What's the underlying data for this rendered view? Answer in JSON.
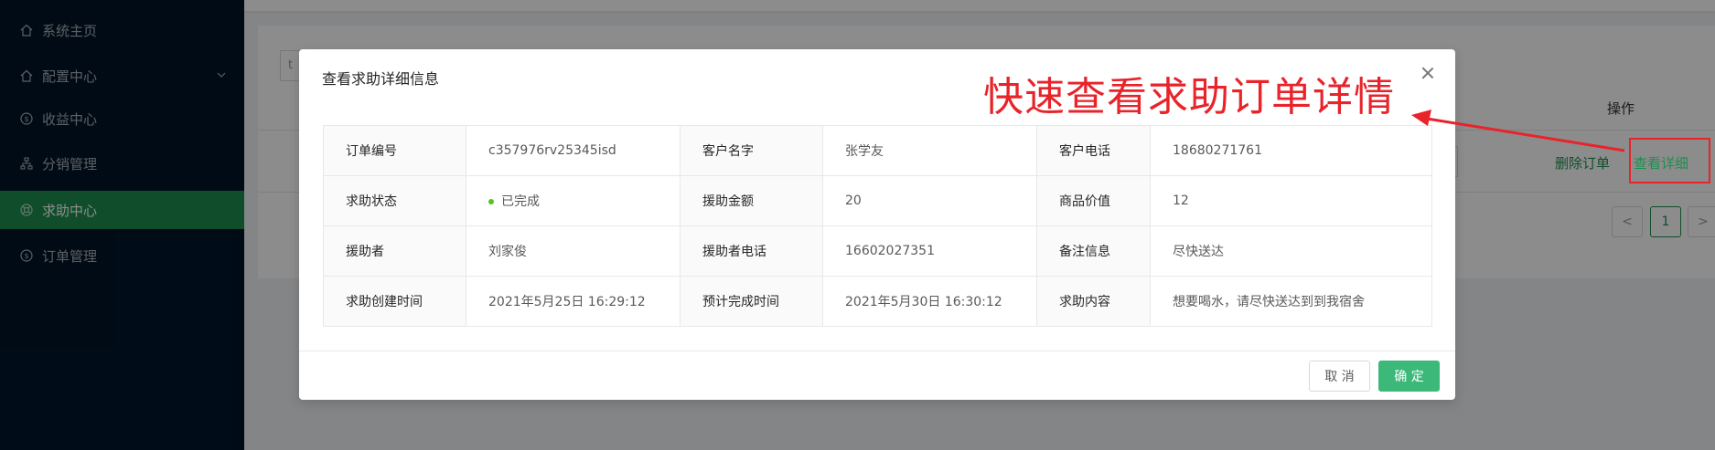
{
  "sidebar": {
    "items": [
      {
        "label": "系统主页",
        "icon": "home-icon"
      },
      {
        "label": "配置中心",
        "icon": "home-icon",
        "has_submenu": true
      },
      {
        "label": "收益中心",
        "icon": "dollar-circle-icon"
      },
      {
        "label": "分销管理",
        "icon": "cluster-icon"
      },
      {
        "label": "求助中心",
        "icon": "help-wheel-icon",
        "active": true
      },
      {
        "label": "订单管理",
        "icon": "dollar-circle-icon"
      }
    ]
  },
  "page": {
    "column_header_action": "操作",
    "row_actions": {
      "delete": "删除订单",
      "view": "查看详细"
    },
    "input_left_text": "t",
    "pager": {
      "prev": "<",
      "current": "1",
      "next": ">"
    }
  },
  "modal": {
    "title": "查看求助详细信息",
    "rows": [
      [
        {
          "label": "订单编号",
          "value": "c357976rv25345isd"
        },
        {
          "label": "客户名字",
          "value": "张学友"
        },
        {
          "label": "客户电话",
          "value": "18680271761"
        }
      ],
      [
        {
          "label": "求助状态",
          "value": "已完成",
          "status_dot": true
        },
        {
          "label": "援助金额",
          "value": "20"
        },
        {
          "label": "商品价值",
          "value": "12"
        }
      ],
      [
        {
          "label": "援助者",
          "value": "刘家俊"
        },
        {
          "label": "援助者电话",
          "value": "16602027351"
        },
        {
          "label": "备注信息",
          "value": "尽快送达"
        }
      ],
      [
        {
          "label": "求助创建时间",
          "value": "2021年5月25日 16:29:12"
        },
        {
          "label": "预计完成时间",
          "value": "2021年5月30日 16:30:12"
        },
        {
          "label": "求助内容",
          "value": "想要喝水，请尽快送达到到我宿舍"
        }
      ]
    ],
    "cancel_label": "取 消",
    "ok_label": "确 定"
  },
  "annotation": {
    "text": "快速查看求助订单详情",
    "color": "#e8232a"
  },
  "colors": {
    "sidebar_bg": "#001529",
    "active": "#1e8e4f",
    "primary_button": "#3cb878",
    "status_success": "#52c41a"
  }
}
